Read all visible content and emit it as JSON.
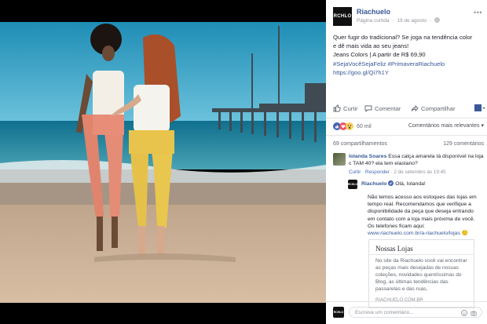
{
  "page": {
    "name": "Riachuelo",
    "logo_text": "RCHLO",
    "meta_sponsored": "Página curtida",
    "meta_sep": "·",
    "meta_date": "19 de agosto",
    "meta_icon": "globe-icon"
  },
  "post": {
    "line1": "Quer fugir do tradicional? Se joga na tendência color",
    "line2": "e dê mais vida ao seu jeans!",
    "line3": "Jeans Colors | A partir de R$ 69,90",
    "hashtags": "#SejaVocêSejaFeliz #PrimaveraRiachuelo",
    "link": "https://goo.gl/Qi7h1Y"
  },
  "actions": {
    "like": "Curtir",
    "comment": "Comentar",
    "share": "Compartilhar"
  },
  "reactions": {
    "count": "60 mil",
    "sort": "Comentários mais relevantes"
  },
  "counts": {
    "shares": "69 compartilhamentos",
    "comments": "129 comentários"
  },
  "comment1": {
    "author": "Iolanda Soares",
    "text": "Essa calça amarela tá disponível na loja c TAM 40? ela tem elastano?",
    "like": "Curtir",
    "reply": "Responder",
    "date": "2 de setembro às 19:45"
  },
  "reply1": {
    "author": "Riachuelo",
    "greeting": "Olá, Iolanda!",
    "body": "Não temos acesso aos estoques das lojas em tempo real. Recomendamos que verifique a disponibilidade da peça que deseja entrando em contato com a loja mais próxima de você. Os telefones ficam aqui:",
    "link": "www.riachuelo.com.br/a-riachuelo/lojas",
    "emoji": "🙂"
  },
  "link_card": {
    "title": "Nossas Lojas",
    "description": "No site da Riachuelo você vai encontrar as peças mais desejadas de nossas coleções, novidades quentíssimas do Blog, as últimas tendências das passarelas e das ruas,",
    "source": "RIACHUELO.COM.BR"
  },
  "composer": {
    "placeholder": "Escreva um comentário..."
  },
  "colors": {
    "link_blue": "#365899",
    "photo_sky": "#2b8fb3"
  }
}
